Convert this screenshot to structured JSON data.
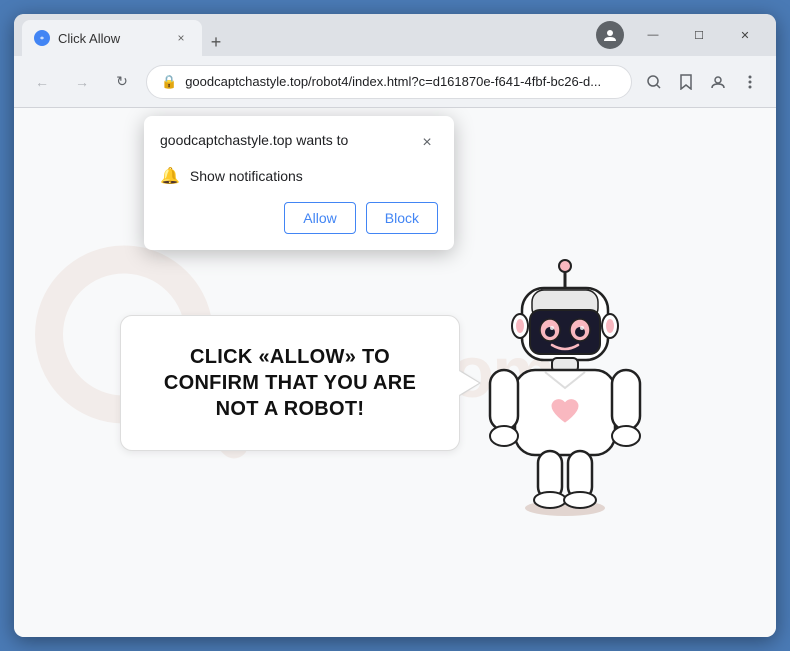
{
  "window": {
    "title": "Click Allow",
    "tab_close_label": "×",
    "new_tab_label": "+"
  },
  "titlebar_controls": {
    "minimize": "—",
    "maximize": "☐",
    "close": "✕"
  },
  "address_bar": {
    "url": "goodcaptchastyle.top/robot4/index.html?c=d161870e-f641-4fbf-bc26-d...",
    "lock_icon": "🔒"
  },
  "nav": {
    "back": "←",
    "forward": "→",
    "refresh": "↻"
  },
  "popup": {
    "site_text": "goodcaptchastyle.top wants to",
    "close_label": "×",
    "notification_text": "Show notifications",
    "allow_label": "Allow",
    "block_label": "Block"
  },
  "page": {
    "captcha_message": "CLICK «ALLOW» TO CONFIRM THAT YOU ARE NOT A ROBOT!",
    "watermark_text": "risk4.com"
  }
}
